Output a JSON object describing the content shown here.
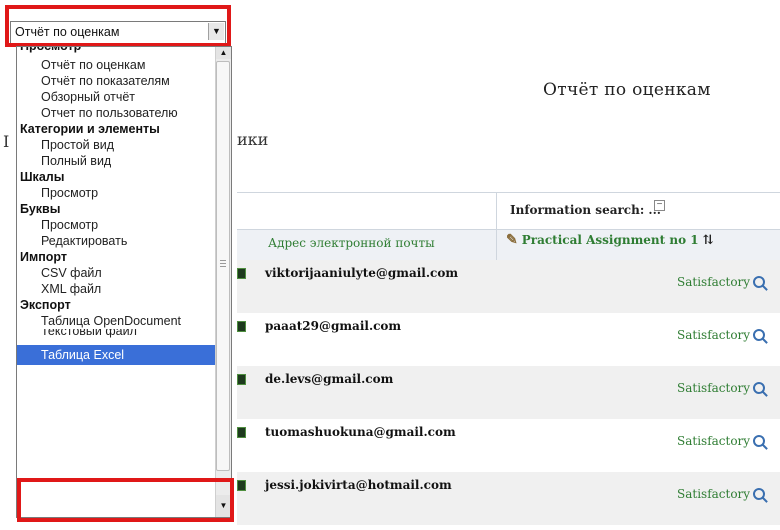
{
  "page": {
    "title": "Отчёт по оценкам",
    "stray_letter": "I",
    "tab_fragment": "ики"
  },
  "grid": {
    "search_label": "Information search: ...",
    "collapse_symbol": "−",
    "col_email": "Адрес электронной почты",
    "col_assignment": "Practical Assignment no 1",
    "sort_symbol": "⇅",
    "edge_fragment": " ",
    "rows": [
      {
        "email": "viktorijaaniulyte@gmail.com",
        "grade": "Satisfactory"
      },
      {
        "email": "paaat29@gmail.com",
        "grade": "Satisfactory"
      },
      {
        "email": "de.levs@gmail.com",
        "grade": "Satisfactory"
      },
      {
        "email": "tuomashuokuna@gmail.com",
        "grade": "Satisfactory"
      },
      {
        "email": "jessi.jokivirta@hotmail.com",
        "grade": "Satisfactory"
      }
    ]
  },
  "select": {
    "value": "Отчёт по оценкам",
    "arrow": "▼"
  },
  "dropdown": {
    "groups": [
      {
        "label": "Просмотр",
        "items": [
          "Отчёт по оценкам",
          "Отчёт по показателям",
          "Обзорный отчёт",
          "Отчет по пользователю"
        ]
      },
      {
        "label": "Категории и элементы",
        "items": [
          "Простой вид",
          "Полный вид"
        ]
      },
      {
        "label": "Шкалы",
        "items": [
          "Просмотр"
        ]
      },
      {
        "label": "Буквы",
        "items": [
          "Просмотр",
          "Редактировать"
        ]
      },
      {
        "label": "Импорт",
        "items": [
          "CSV файл",
          "XML файл"
        ]
      },
      {
        "label": "Экспорт",
        "items": [
          "Таблица OpenDocument",
          "Текстовый файл"
        ]
      }
    ],
    "selected_item": "Таблица Excel",
    "scroll_up": "▲",
    "scroll_down": "▼"
  },
  "colors": {
    "highlight": "#e01818",
    "selection": "#3a6fd8",
    "grade_text": "#2f7d33"
  }
}
